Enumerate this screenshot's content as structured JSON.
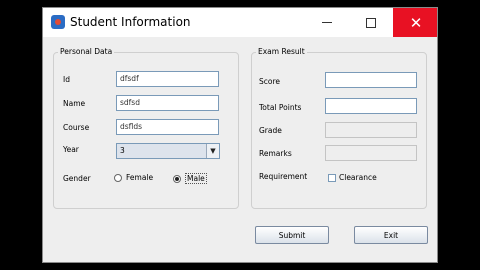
{
  "window": {
    "title": "Student Information",
    "close_glyph": "✕"
  },
  "personal": {
    "title": "Personal Data",
    "id_label": "Id",
    "id_value": "dfsdf",
    "name_label": "Name",
    "name_value": "sdfsd",
    "course_label": "Course",
    "course_value": "dsflds",
    "year_label": "Year",
    "year_value": "3",
    "gender_label": "Gender",
    "female_label": "Female",
    "male_label": "Male",
    "gender_selected": "Male"
  },
  "exam": {
    "title": "Exam Result",
    "score_label": "Score",
    "score_value": "",
    "total_label": "Total Points",
    "total_value": "",
    "grade_label": "Grade",
    "grade_value": "",
    "remarks_label": "Remarks",
    "remarks_value": "",
    "requirement_label": "Requirement",
    "clearance_label": "Clearance",
    "clearance_checked": false
  },
  "actions": {
    "submit_label": "Submit",
    "exit_label": "Exit"
  },
  "icons": {
    "app": "app-icon",
    "minimize": "minimize-icon",
    "maximize": "maximize-icon",
    "close": "close-icon",
    "dropdown": "chevron-down-icon"
  },
  "colors": {
    "close_bg": "#e81123",
    "window_bg": "#eeeeee",
    "field_border": "#7a9ab8"
  }
}
